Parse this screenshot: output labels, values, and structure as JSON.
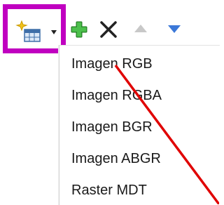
{
  "toolbar": {
    "icons": [
      "new-raster-layer-icon",
      "chevron-down-icon",
      "add-icon",
      "delete-icon",
      "move-up-icon",
      "move-down-icon"
    ]
  },
  "menu": {
    "items": [
      {
        "label": "Imagen RGB"
      },
      {
        "label": "Imagen RGBA"
      },
      {
        "label": "Imagen BGR"
      },
      {
        "label": "Imagen ABGR"
      },
      {
        "label": "Raster MDT"
      }
    ]
  },
  "colors": {
    "highlight": "#c000c0",
    "annotation_line": "#e00000",
    "add_green": "#3aa63a",
    "arrow_blue": "#3b78d8",
    "arrow_gray": "#c8c8c8"
  }
}
